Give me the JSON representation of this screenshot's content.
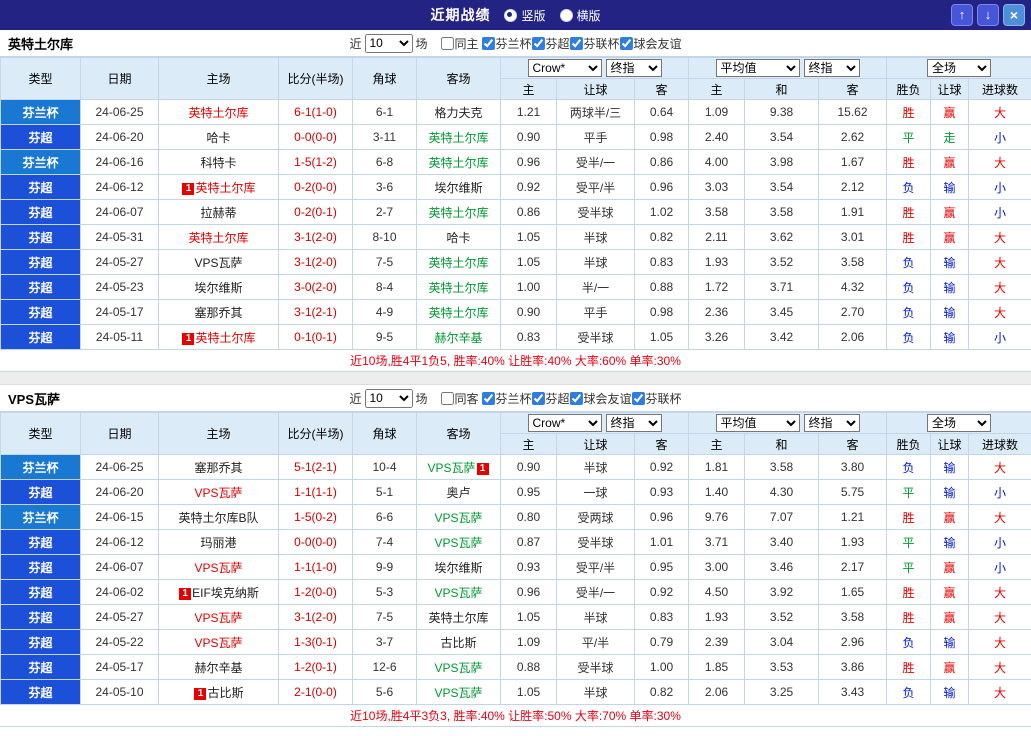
{
  "topbar": {
    "title": "近期战绩",
    "vertical": "竖版",
    "horizontal": "横版",
    "up": "↑",
    "down": "↓",
    "close": "×"
  },
  "columns": {
    "type": "类型",
    "date": "日期",
    "home": "主场",
    "score": "比分(半场)",
    "corners": "角球",
    "away": "客场",
    "odds_home": "主",
    "odds_handicap": "让球",
    "odds_away": "客",
    "avg_home": "主",
    "avg_draw": "和",
    "avg_away": "客",
    "result": "胜负",
    "result_handicap": "让球",
    "result_goals": "进球数"
  },
  "selects": {
    "provider": "Crow*",
    "final1": "终指",
    "average": "平均值",
    "final2": "终指",
    "full": "全场"
  },
  "colors": {
    "win": "#e60000",
    "lose": "#0016d0",
    "draw": "#009933",
    "cup_blue": "#1878d2",
    "league_blue": "#1c50d8",
    "score_red": "#d10000",
    "topbar": "#232384"
  },
  "sections": [
    {
      "team": "英特土尔库",
      "filter": {
        "near": "近",
        "count": "10",
        "unit": "场",
        "same_label": "同主",
        "same_checked": false,
        "leagues": [
          "芬兰杯",
          "芬超",
          "芬联杯",
          "球会友谊"
        ]
      },
      "rows": [
        {
          "type": "芬兰杯",
          "type_class": "cup",
          "date": "24-06-25",
          "home": {
            "name": "英特土尔库",
            "color": "red"
          },
          "score": "6-1(1-0)",
          "corners": "6-1",
          "away": {
            "name": "格力夫克",
            "color": "black"
          },
          "odds": [
            "1.21",
            "两球半/三",
            "0.64"
          ],
          "avg": [
            "1.09",
            "9.38",
            "15.62"
          ],
          "outcome": [
            [
              "胜",
              "red"
            ],
            [
              "赢",
              "red"
            ],
            [
              "大",
              "red"
            ]
          ]
        },
        {
          "type": "芬超",
          "type_class": "league",
          "date": "24-06-20",
          "home": {
            "name": "哈卡",
            "color": "black"
          },
          "score": "0-0(0-0)",
          "corners": "3-11",
          "away": {
            "name": "英特土尔库",
            "color": "green"
          },
          "odds": [
            "0.90",
            "平手",
            "0.98"
          ],
          "avg": [
            "2.40",
            "3.54",
            "2.62"
          ],
          "outcome": [
            [
              "平",
              "green"
            ],
            [
              "走",
              "green"
            ],
            [
              "小",
              "blue"
            ]
          ]
        },
        {
          "type": "芬兰杯",
          "type_class": "cup",
          "date": "24-06-16",
          "home": {
            "name": "科特卡",
            "color": "black"
          },
          "score": "1-5(1-2)",
          "corners": "6-8",
          "away": {
            "name": "英特土尔库",
            "color": "green"
          },
          "odds": [
            "0.96",
            "受半/一",
            "0.86"
          ],
          "avg": [
            "4.00",
            "3.98",
            "1.67"
          ],
          "outcome": [
            [
              "胜",
              "red"
            ],
            [
              "赢",
              "red"
            ],
            [
              "大",
              "red"
            ]
          ]
        },
        {
          "type": "芬超",
          "type_class": "league",
          "date": "24-06-12",
          "home": {
            "name": "英特土尔库",
            "color": "red",
            "badge": "1",
            "badge_pos": "before"
          },
          "score": "0-2(0-0)",
          "corners": "3-6",
          "away": {
            "name": "埃尔维斯",
            "color": "black"
          },
          "odds": [
            "0.92",
            "受平/半",
            "0.96"
          ],
          "avg": [
            "3.03",
            "3.54",
            "2.12"
          ],
          "outcome": [
            [
              "负",
              "blue"
            ],
            [
              "输",
              "blue"
            ],
            [
              "小",
              "blue"
            ]
          ]
        },
        {
          "type": "芬超",
          "type_class": "league",
          "date": "24-06-07",
          "home": {
            "name": "拉赫蒂",
            "color": "black"
          },
          "score": "0-2(0-1)",
          "corners": "2-7",
          "away": {
            "name": "英特土尔库",
            "color": "green"
          },
          "odds": [
            "0.86",
            "受半球",
            "1.02"
          ],
          "avg": [
            "3.58",
            "3.58",
            "1.91"
          ],
          "outcome": [
            [
              "胜",
              "red"
            ],
            [
              "赢",
              "red"
            ],
            [
              "小",
              "blue"
            ]
          ]
        },
        {
          "type": "芬超",
          "type_class": "league",
          "date": "24-05-31",
          "home": {
            "name": "英特土尔库",
            "color": "red"
          },
          "score": "3-1(2-0)",
          "corners": "8-10",
          "away": {
            "name": "哈卡",
            "color": "black"
          },
          "odds": [
            "1.05",
            "半球",
            "0.82"
          ],
          "avg": [
            "2.11",
            "3.62",
            "3.01"
          ],
          "outcome": [
            [
              "胜",
              "red"
            ],
            [
              "赢",
              "red"
            ],
            [
              "大",
              "red"
            ]
          ]
        },
        {
          "type": "芬超",
          "type_class": "league",
          "date": "24-05-27",
          "home": {
            "name": "VPS瓦萨",
            "color": "black"
          },
          "score": "3-1(2-0)",
          "corners": "7-5",
          "away": {
            "name": "英特土尔库",
            "color": "green"
          },
          "odds": [
            "1.05",
            "半球",
            "0.83"
          ],
          "avg": [
            "1.93",
            "3.52",
            "3.58"
          ],
          "outcome": [
            [
              "负",
              "blue"
            ],
            [
              "输",
              "blue"
            ],
            [
              "大",
              "red"
            ]
          ]
        },
        {
          "type": "芬超",
          "type_class": "league",
          "date": "24-05-23",
          "home": {
            "name": "埃尔维斯",
            "color": "black"
          },
          "score": "3-0(2-0)",
          "corners": "8-4",
          "away": {
            "name": "英特土尔库",
            "color": "green"
          },
          "odds": [
            "1.00",
            "半/一",
            "0.88"
          ],
          "avg": [
            "1.72",
            "3.71",
            "4.32"
          ],
          "outcome": [
            [
              "负",
              "blue"
            ],
            [
              "输",
              "blue"
            ],
            [
              "大",
              "red"
            ]
          ]
        },
        {
          "type": "芬超",
          "type_class": "league",
          "date": "24-05-17",
          "home": {
            "name": "塞那乔其",
            "color": "black"
          },
          "score": "3-1(2-1)",
          "corners": "4-9",
          "away": {
            "name": "英特土尔库",
            "color": "green"
          },
          "odds": [
            "0.90",
            "平手",
            "0.98"
          ],
          "avg": [
            "2.36",
            "3.45",
            "2.70"
          ],
          "outcome": [
            [
              "负",
              "blue"
            ],
            [
              "输",
              "blue"
            ],
            [
              "大",
              "red"
            ]
          ]
        },
        {
          "type": "芬超",
          "type_class": "league",
          "date": "24-05-11",
          "home": {
            "name": "英特土尔库",
            "color": "red",
            "badge": "1",
            "badge_pos": "before"
          },
          "score": "0-1(0-1)",
          "corners": "9-5",
          "away": {
            "name": "赫尔辛基",
            "color": "green"
          },
          "odds": [
            "0.83",
            "受半球",
            "1.05"
          ],
          "avg": [
            "3.26",
            "3.42",
            "2.06"
          ],
          "outcome": [
            [
              "负",
              "blue"
            ],
            [
              "输",
              "blue"
            ],
            [
              "小",
              "blue"
            ]
          ]
        }
      ],
      "summary": "近10场,胜4平1负5, 胜率:40% 让胜率:40% 大率:60% 单率:30%"
    },
    {
      "team": "VPS瓦萨",
      "filter": {
        "near": "近",
        "count": "10",
        "unit": "场",
        "same_label": "同客",
        "same_checked": false,
        "leagues": [
          "芬兰杯",
          "芬超",
          "球会友谊",
          "芬联杯"
        ]
      },
      "rows": [
        {
          "type": "芬兰杯",
          "type_class": "cup",
          "date": "24-06-25",
          "home": {
            "name": "塞那乔其",
            "color": "black"
          },
          "score": "5-1(2-1)",
          "corners": "10-4",
          "away": {
            "name": "VPS瓦萨",
            "color": "green",
            "badge": "1",
            "badge_pos": "after"
          },
          "odds": [
            "0.90",
            "半球",
            "0.92"
          ],
          "avg": [
            "1.81",
            "3.58",
            "3.80"
          ],
          "outcome": [
            [
              "负",
              "blue"
            ],
            [
              "输",
              "blue"
            ],
            [
              "大",
              "red"
            ]
          ]
        },
        {
          "type": "芬超",
          "type_class": "league",
          "date": "24-06-20",
          "home": {
            "name": "VPS瓦萨",
            "color": "red"
          },
          "score": "1-1(1-1)",
          "corners": "5-1",
          "away": {
            "name": "奥卢",
            "color": "black"
          },
          "odds": [
            "0.95",
            "一球",
            "0.93"
          ],
          "avg": [
            "1.40",
            "4.30",
            "5.75"
          ],
          "outcome": [
            [
              "平",
              "green"
            ],
            [
              "输",
              "blue"
            ],
            [
              "小",
              "blue"
            ]
          ]
        },
        {
          "type": "芬兰杯",
          "type_class": "cup",
          "date": "24-06-15",
          "home": {
            "name": "英特土尔库B队",
            "color": "black"
          },
          "score": "1-5(0-2)",
          "corners": "6-6",
          "away": {
            "name": "VPS瓦萨",
            "color": "green"
          },
          "odds": [
            "0.80",
            "受两球",
            "0.96"
          ],
          "avg": [
            "9.76",
            "7.07",
            "1.21"
          ],
          "outcome": [
            [
              "胜",
              "red"
            ],
            [
              "赢",
              "red"
            ],
            [
              "大",
              "red"
            ]
          ]
        },
        {
          "type": "芬超",
          "type_class": "league",
          "date": "24-06-12",
          "home": {
            "name": "玛丽港",
            "color": "black"
          },
          "score": "0-0(0-0)",
          "corners": "7-4",
          "away": {
            "name": "VPS瓦萨",
            "color": "green"
          },
          "odds": [
            "0.87",
            "受半球",
            "1.01"
          ],
          "avg": [
            "3.71",
            "3.40",
            "1.93"
          ],
          "outcome": [
            [
              "平",
              "green"
            ],
            [
              "输",
              "blue"
            ],
            [
              "小",
              "blue"
            ]
          ]
        },
        {
          "type": "芬超",
          "type_class": "league",
          "date": "24-06-07",
          "home": {
            "name": "VPS瓦萨",
            "color": "red"
          },
          "score": "1-1(1-0)",
          "corners": "9-9",
          "away": {
            "name": "埃尔维斯",
            "color": "black"
          },
          "odds": [
            "0.93",
            "受平/半",
            "0.95"
          ],
          "avg": [
            "3.00",
            "3.46",
            "2.17"
          ],
          "outcome": [
            [
              "平",
              "green"
            ],
            [
              "赢",
              "red"
            ],
            [
              "小",
              "blue"
            ]
          ]
        },
        {
          "type": "芬超",
          "type_class": "league",
          "date": "24-06-02",
          "home": {
            "name": "EIF埃克纳斯",
            "color": "black",
            "badge": "1",
            "badge_pos": "before"
          },
          "score": "1-2(0-0)",
          "corners": "5-3",
          "away": {
            "name": "VPS瓦萨",
            "color": "green"
          },
          "odds": [
            "0.96",
            "受半/一",
            "0.92"
          ],
          "avg": [
            "4.50",
            "3.92",
            "1.65"
          ],
          "outcome": [
            [
              "胜",
              "red"
            ],
            [
              "赢",
              "red"
            ],
            [
              "大",
              "red"
            ]
          ]
        },
        {
          "type": "芬超",
          "type_class": "league",
          "date": "24-05-27",
          "home": {
            "name": "VPS瓦萨",
            "color": "red"
          },
          "score": "3-1(2-0)",
          "corners": "7-5",
          "away": {
            "name": "英特土尔库",
            "color": "black"
          },
          "odds": [
            "1.05",
            "半球",
            "0.83"
          ],
          "avg": [
            "1.93",
            "3.52",
            "3.58"
          ],
          "outcome": [
            [
              "胜",
              "red"
            ],
            [
              "赢",
              "red"
            ],
            [
              "大",
              "red"
            ]
          ]
        },
        {
          "type": "芬超",
          "type_class": "league",
          "date": "24-05-22",
          "home": {
            "name": "VPS瓦萨",
            "color": "red"
          },
          "score": "1-3(0-1)",
          "corners": "3-7",
          "away": {
            "name": "古比斯",
            "color": "black"
          },
          "odds": [
            "1.09",
            "平/半",
            "0.79"
          ],
          "avg": [
            "2.39",
            "3.04",
            "2.96"
          ],
          "outcome": [
            [
              "负",
              "blue"
            ],
            [
              "输",
              "blue"
            ],
            [
              "大",
              "red"
            ]
          ]
        },
        {
          "type": "芬超",
          "type_class": "league",
          "date": "24-05-17",
          "home": {
            "name": "赫尔辛基",
            "color": "black"
          },
          "score": "1-2(0-1)",
          "corners": "12-6",
          "away": {
            "name": "VPS瓦萨",
            "color": "green"
          },
          "odds": [
            "0.88",
            "受半球",
            "1.00"
          ],
          "avg": [
            "1.85",
            "3.53",
            "3.86"
          ],
          "outcome": [
            [
              "胜",
              "red"
            ],
            [
              "赢",
              "red"
            ],
            [
              "大",
              "red"
            ]
          ]
        },
        {
          "type": "芬超",
          "type_class": "league",
          "date": "24-05-10",
          "home": {
            "name": "古比斯",
            "color": "black",
            "badge": "1",
            "badge_pos": "before"
          },
          "score": "2-1(0-0)",
          "corners": "5-6",
          "away": {
            "name": "VPS瓦萨",
            "color": "green"
          },
          "odds": [
            "1.05",
            "半球",
            "0.82"
          ],
          "avg": [
            "2.06",
            "3.25",
            "3.43"
          ],
          "outcome": [
            [
              "负",
              "blue"
            ],
            [
              "输",
              "blue"
            ],
            [
              "大",
              "red"
            ]
          ]
        }
      ],
      "summary": "近10场,胜4平3负3, 胜率:40% 让胜率:50% 大率:70% 单率:30%"
    }
  ]
}
